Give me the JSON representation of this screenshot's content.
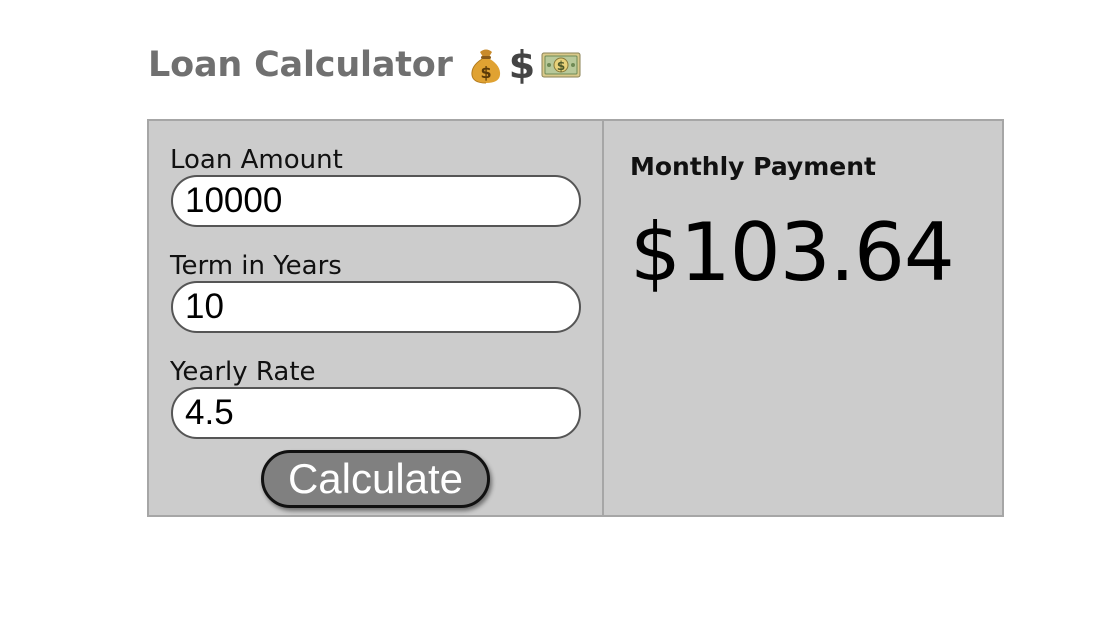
{
  "header": {
    "title": "Loan Calculator",
    "icons": [
      "money-bag-icon",
      "dollar-sign-icon",
      "dollar-banknote-icon"
    ],
    "dollar_symbol": "$"
  },
  "form": {
    "loan_amount": {
      "label": "Loan Amount",
      "value": "10000"
    },
    "term_years": {
      "label": "Term in Years",
      "value": "10"
    },
    "yearly_rate": {
      "label": "Yearly Rate",
      "value": "4.5"
    },
    "calculate_label": "Calculate"
  },
  "result": {
    "label": "Monthly Payment",
    "value": "$103.64"
  },
  "colors": {
    "panel_background": "#cccccc",
    "panel_border": "#a6a6a6",
    "title_text": "#707070",
    "button_background": "#808080",
    "button_text": "#ffffff"
  }
}
